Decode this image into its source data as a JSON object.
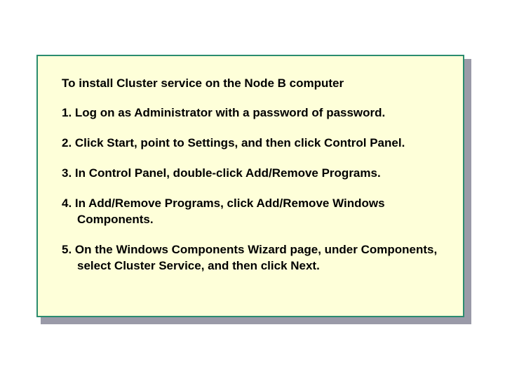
{
  "document": {
    "title": "To install Cluster service on the Node B computer",
    "steps": [
      "1. Log on as Administrator with a password of password.",
      "2. Click Start, point to Settings, and then click Control Panel.",
      "3. In Control Panel, double-click Add/Remove Programs.",
      "4. In Add/Remove Programs, click Add/Remove Windows Components.",
      "5. On the Windows Components Wizard page, under Components, select Cluster Service, and then click Next."
    ]
  }
}
